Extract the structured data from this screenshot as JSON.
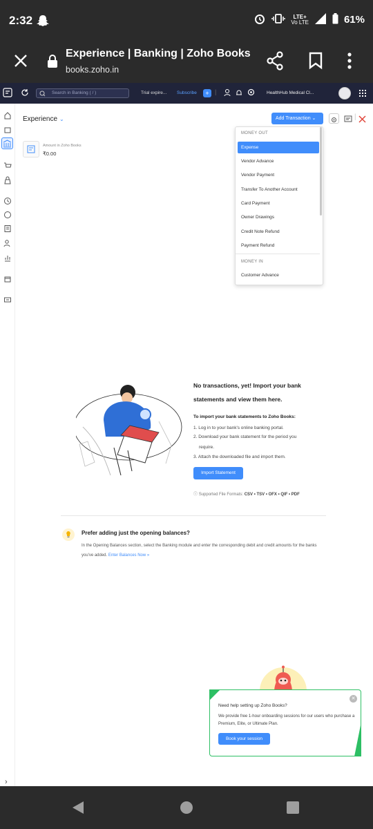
{
  "status_bar": {
    "time": "2:32",
    "network": "Vo LTE",
    "network_sub": "LTE+",
    "battery": "61%"
  },
  "browser": {
    "title": "Experience | Banking | Zoho Books",
    "url": "books.zoho.in"
  },
  "top_nav": {
    "search_placeholder": "Search in Banking ( / )",
    "trial_text": "Trial expire...",
    "subscribe": "Subscribe",
    "org_name": "HealthHub Medical Cl..."
  },
  "header": {
    "account_title": "Experience",
    "add_transaction": "Add Transaction"
  },
  "account_card": {
    "label": "Amount in Zoho Books",
    "amount": "₹0.00"
  },
  "dropdown": {
    "money_out_header": "MONEY OUT",
    "money_out_items": [
      "Expense",
      "Vendor Advance",
      "Vendor Payment",
      "Transfer To Another Account",
      "Card Payment",
      "Owner Drawings",
      "Credit Note Refund",
      "Payment Refund"
    ],
    "money_in_header": "MONEY IN",
    "money_in_items": [
      "Customer Advance"
    ]
  },
  "empty_state": {
    "heading_line1": "No transactions, yet! Import your bank",
    "heading_line2": "statements and view them here.",
    "sub_heading": "To import your bank statements to Zoho Books:",
    "step1": "1. Log in to your bank's online banking portal.",
    "step2a": "2. Download your bank statement for the period you",
    "step2b": "require.",
    "step3": "3. Attach the downloaded file and import them.",
    "import_button": "Import Statement",
    "formats_label": "Supported File Formats:",
    "formats": "CSV • TSV • OFX • QIF • PDF"
  },
  "opening_balance": {
    "heading": "Prefer adding just the opening balances?",
    "text": "In the Opening Balances section, select the Banking module and enter the corresponding debit and credit amounts for the banks you've added.",
    "link": "Enter Balances Now »"
  },
  "help_card": {
    "question": "Need help setting up Zoho Books?",
    "text": "We provide free 1-hour onboarding sessions for our users who purchase a Premium, Elite, or Ultimate Plan.",
    "button": "Book your session"
  },
  "colors": {
    "accent": "#408dfb",
    "nav_bg": "#20243a",
    "android_bar": "#2b2b2b",
    "help_border": "#2dbf64",
    "close_red": "#e0453a"
  }
}
